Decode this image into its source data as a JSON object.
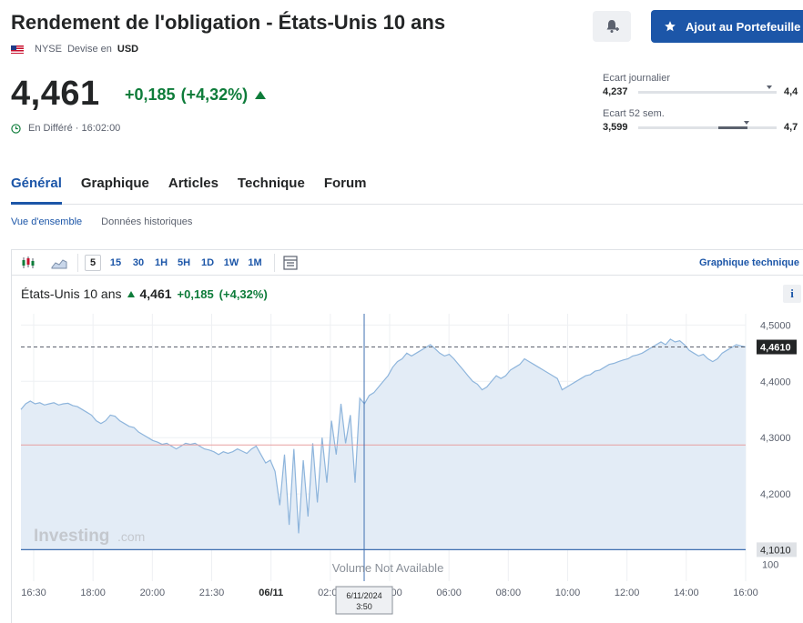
{
  "header": {
    "title": "Rendement de l'obligation - États-Unis 10 ans",
    "exchange": "NYSE",
    "currency_label": "Devise en",
    "currency": "USD",
    "portfolio_button": "Ajout au Portefeuille"
  },
  "quote": {
    "price": "4,461",
    "change": "+0,185",
    "change_pct": "(+4,32%)",
    "delay_text": "En Différé · 16:02:00"
  },
  "ranges": {
    "daily": {
      "label": "Ecart journalier",
      "low": "4,237",
      "high": "4,4",
      "current_fraction": 0.95
    },
    "week52": {
      "label": "Ecart 52 sem.",
      "low": "3,599",
      "high": "4,7",
      "fill_fraction_start": 0.58,
      "fill_fraction_end": 0.79,
      "current_fraction": 0.78
    }
  },
  "tabs": [
    {
      "label": "Général",
      "active": true
    },
    {
      "label": "Graphique",
      "active": false
    },
    {
      "label": "Articles",
      "active": false
    },
    {
      "label": "Technique",
      "active": false
    },
    {
      "label": "Forum",
      "active": false
    }
  ],
  "subtabs": [
    {
      "label": "Vue d'ensemble",
      "active": true
    },
    {
      "label": "Données historiques",
      "active": false
    }
  ],
  "toolbar": {
    "periods": [
      "5",
      "15",
      "30",
      "1H",
      "5H",
      "1D",
      "1W",
      "1M"
    ],
    "selected_period": "5",
    "technical_link": "Graphique technique"
  },
  "chart_legend": {
    "name": "États-Unis 10 ans",
    "price": "4,461",
    "change": "+0,185",
    "change_pct": "(+4,32%)"
  },
  "chart_data": {
    "type": "area",
    "x_tick_labels": [
      "16:30",
      "18:00",
      "20:00",
      "21:30",
      "06/11",
      "02:00",
      "04:00",
      "06:00",
      "08:00",
      "10:00",
      "12:00",
      "14:00",
      "16:00"
    ],
    "y_tick_labels": [
      "4,5000",
      "4,4000",
      "4,3000",
      "4,2000"
    ],
    "ylim": [
      4.1,
      4.52
    ],
    "current_price_label": "4,4610",
    "current_price": 4.461,
    "previous_close_line": 4.287,
    "min_line_label": "4,1010",
    "min_line": 4.101,
    "volume_text": "Volume Not Available",
    "volume_axis_label": "100",
    "crosshair_label_date": "6/11/2024",
    "crosshair_label_time": "3:50",
    "watermark": "Investing",
    "watermark_suffix": ".com",
    "series": [
      {
        "values": [
          4.35,
          4.36,
          4.365,
          4.36,
          4.362,
          4.358,
          4.36,
          4.362,
          4.358,
          4.36,
          4.361,
          4.357,
          4.355,
          4.35,
          4.345,
          4.34,
          4.33,
          4.325,
          4.33,
          4.34,
          4.338,
          4.33,
          4.325,
          4.32,
          4.318,
          4.31,
          4.305,
          4.3,
          4.295,
          4.292,
          4.288,
          4.29,
          4.285,
          4.28,
          4.285,
          4.29,
          4.288,
          4.29,
          4.285,
          4.28,
          4.278,
          4.275,
          4.27,
          4.275,
          4.272,
          4.275,
          4.28,
          4.276,
          4.272,
          4.28,
          4.285,
          4.27,
          4.255,
          4.26,
          4.24,
          4.18,
          4.27,
          4.145,
          4.28,
          4.13,
          4.26,
          4.16,
          4.29,
          4.185,
          4.3,
          4.22,
          4.33,
          4.27,
          4.36,
          4.29,
          4.34,
          4.22,
          4.37,
          4.36,
          4.375,
          4.38,
          4.39,
          4.4,
          4.41,
          4.425,
          4.435,
          4.44,
          4.45,
          4.445,
          4.45,
          4.455,
          4.46,
          4.465,
          4.458,
          4.45,
          4.445,
          4.448,
          4.44,
          4.43,
          4.42,
          4.41,
          4.4,
          4.395,
          4.385,
          4.39,
          4.4,
          4.41,
          4.405,
          4.41,
          4.42,
          4.425,
          4.43,
          4.44,
          4.435,
          4.43,
          4.425,
          4.42,
          4.415,
          4.41,
          4.405,
          4.385,
          4.39,
          4.395,
          4.4,
          4.405,
          4.41,
          4.412,
          4.418,
          4.42,
          4.425,
          4.43,
          4.432,
          4.435,
          4.438,
          4.44,
          4.445,
          4.447,
          4.45,
          4.455,
          4.46,
          4.465,
          4.47,
          4.465,
          4.475,
          4.47,
          4.472,
          4.465,
          4.455,
          4.45,
          4.445,
          4.448,
          4.44,
          4.435,
          4.44,
          4.45,
          4.455,
          4.46,
          4.465,
          4.463,
          4.461
        ]
      }
    ]
  }
}
